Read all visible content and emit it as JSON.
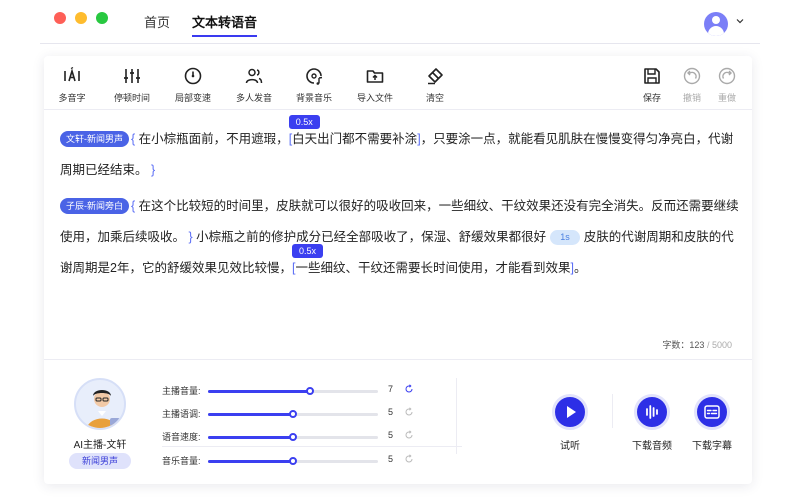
{
  "nav": {
    "home": "首页",
    "tts": "文本转语音"
  },
  "toolbar": {
    "left": [
      {
        "name": "polyphone",
        "label": "多音字",
        "icon": "polyphone-icon"
      },
      {
        "name": "pause-time",
        "label": "停顿时间",
        "icon": "sliders-icon"
      },
      {
        "name": "local-speed",
        "label": "局部变速",
        "icon": "speed-dial-icon"
      },
      {
        "name": "multi-voice",
        "label": "多人发音",
        "icon": "users-icon"
      },
      {
        "name": "bg-music",
        "label": "背景音乐",
        "icon": "music-disc-icon"
      },
      {
        "name": "import-file",
        "label": "导入文件",
        "icon": "folder-upload-icon"
      },
      {
        "name": "clear",
        "label": "清空",
        "icon": "eraser-icon"
      }
    ],
    "right": [
      {
        "name": "save",
        "label": "保存",
        "icon": "save-icon"
      },
      {
        "name": "undo",
        "label": "撤销",
        "icon": "undo-icon"
      },
      {
        "name": "redo",
        "label": "重做",
        "icon": "redo-icon"
      }
    ]
  },
  "editor": {
    "p1_tag": "文轩-新闻男声",
    "p1_a": "在小棕瓶面前，不用遮瑕，",
    "p1_speed": "0.5x",
    "p1_b": "白天出门都不需要补涂",
    "p1_c": "，只要涂一点，就能看见肌肤在慢慢变得匀净亮白，代谢周期已经结束。",
    "p2_tag": "子辰-新闻旁白",
    "p2_a": "在这个比较短的时间里，皮肤就可以很好的吸收回来，一些细纹、干纹效果还没有完全消失。反而还需要继续使用，加乘后续吸收。",
    "p2_b": "小棕瓶之前的修护成分已经全部吸收了，保湿、舒缓效果都很好",
    "p2_pause": "1s",
    "p2_c": "皮肤的代谢周期和皮肤的代谢周期是2年，它的舒缓效果见效比较慢，",
    "p2_speed": "0.5x",
    "p2_d": "一些细纹、干纹还需要长时间使用，才能看到效果",
    "p2_end": "。"
  },
  "count": {
    "label": "字数：",
    "current": "123",
    "max": "/ 5000"
  },
  "anchor": {
    "name": "AI主播-文轩",
    "voice": "新闻男声"
  },
  "sliders": [
    {
      "label": "主播音量:",
      "value": "7",
      "level": 0.6,
      "active": true
    },
    {
      "label": "主播语调:",
      "value": "5",
      "level": 0.5,
      "active": false
    },
    {
      "label": "语音速度:",
      "value": "5",
      "level": 0.5,
      "active": false
    },
    {
      "label": "音乐音量:",
      "value": "5",
      "level": 0.5,
      "active": false
    }
  ],
  "actions": {
    "listen": "试听",
    "download_audio": "下载音频",
    "download_subtitle": "下载字幕"
  },
  "colors": {
    "accent": "#3b3ff0",
    "tag": "#4a63e6",
    "pause_bg": "#d5e6fb"
  }
}
